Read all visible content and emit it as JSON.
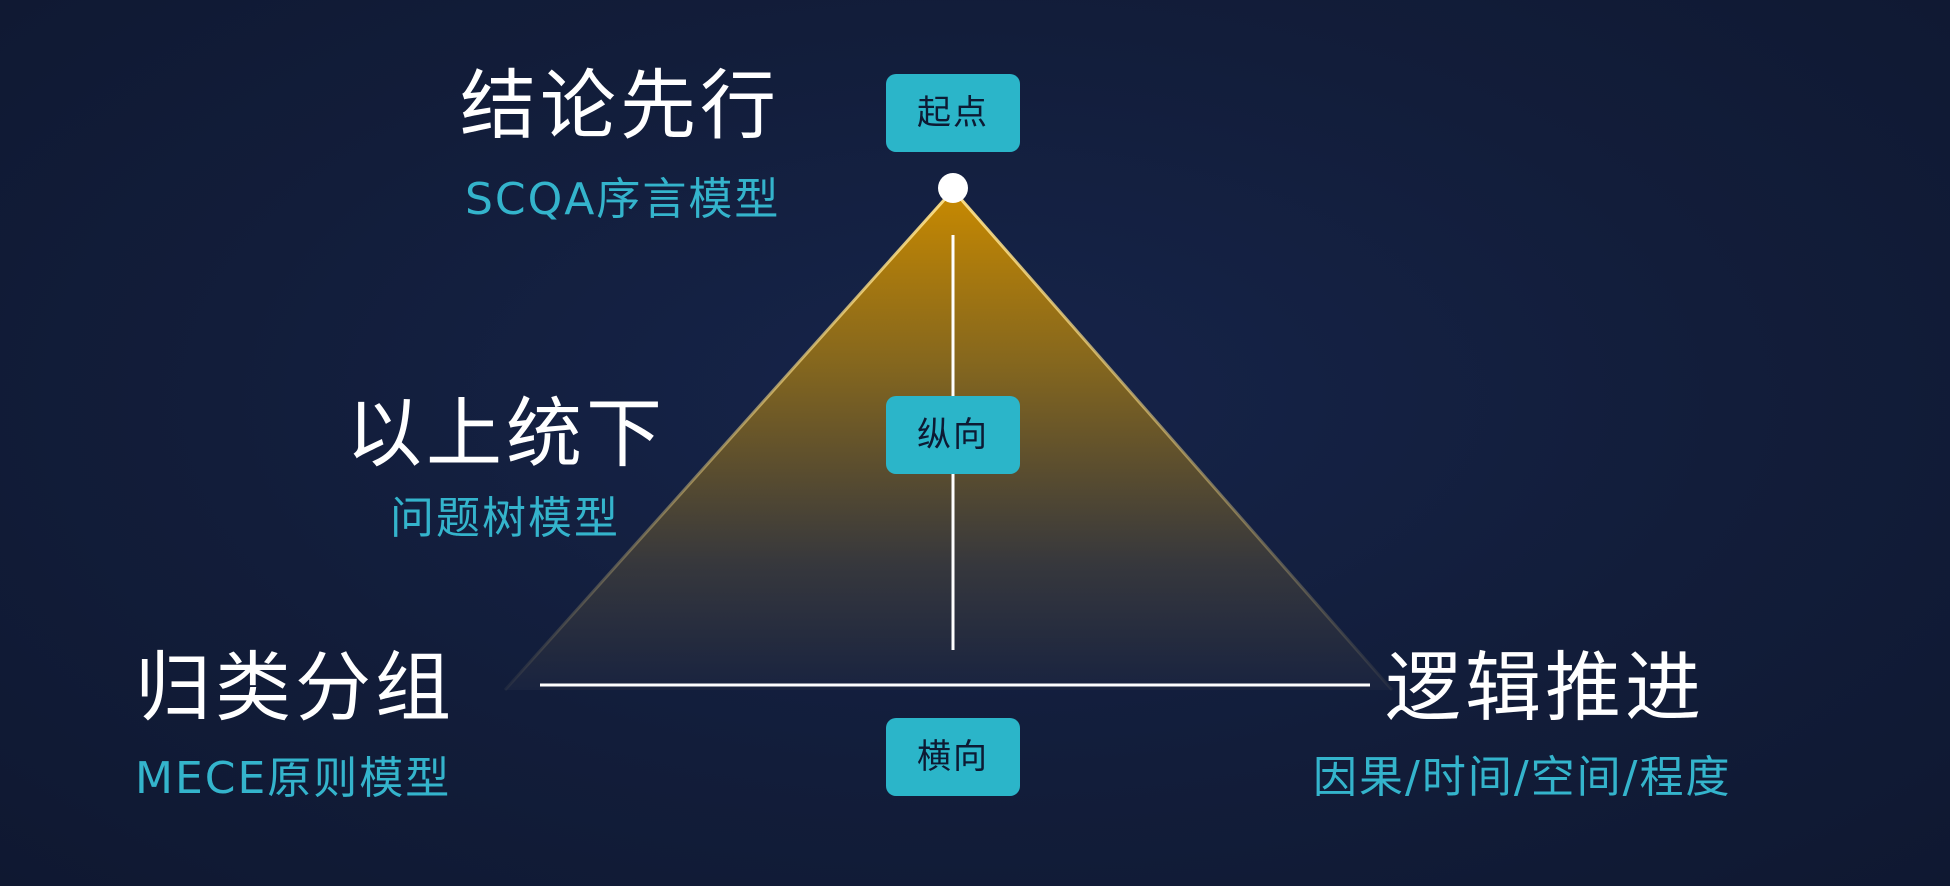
{
  "colors": {
    "background": "#121d38",
    "main_text": "#ffffff",
    "sub_text": "#34b4cc",
    "badge_fill": "#2bb5c9",
    "badge_text": "#0d1a33",
    "triangle_top": "#c98a00",
    "triangle_bottom": "#1a2440",
    "axis_line": "#ffffff"
  },
  "apex": {
    "label": "结论先行",
    "sublabel": "SCQA序言模型",
    "badge": "起点"
  },
  "middle": {
    "label": "以上统下",
    "sublabel": "问题树模型",
    "badge": "纵向"
  },
  "bottom_left": {
    "label": "归类分组",
    "sublabel": "MECE原则模型"
  },
  "bottom_right": {
    "label": "逻辑推进",
    "sublabel": "因果/时间/空间/程度"
  },
  "horizontal": {
    "badge": "横向"
  }
}
